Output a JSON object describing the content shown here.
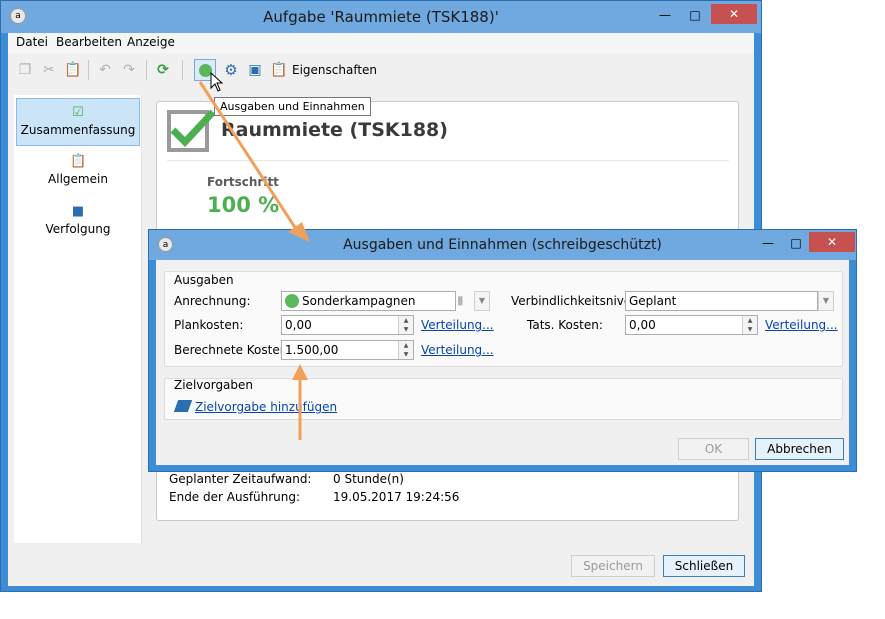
{
  "main_window": {
    "title": "Aufgabe 'Raummiete (TSK188)'",
    "menu": [
      "Datei",
      "Bearbeiten",
      "Anzeige"
    ],
    "toolbar": {
      "properties_label": "Eigenschaften",
      "tooltip": "Ausgaben und Einnahmen"
    },
    "sidebar": [
      {
        "label": "Zusammenfassung",
        "icon": "checklist-icon"
      },
      {
        "label": "Allgemein",
        "icon": "clipboard-icon"
      },
      {
        "label": "Verfolgung",
        "icon": "tracking-icon"
      }
    ],
    "summary": {
      "title": "Raummiete (TSK188)",
      "progress_label": "Fortschritt",
      "progress_value": "100 %",
      "details": [
        {
          "label": "Geplanter Zeitaufwand:",
          "value": "0 Stunde(n)"
        },
        {
          "label": "Ende der Ausführung:",
          "value": "19.05.2017 19:24:56"
        }
      ]
    },
    "buttons": {
      "save": "Speichern",
      "close": "Schließen"
    }
  },
  "dialog": {
    "title": "Ausgaben und Einnahmen (schreibgeschützt)",
    "ausgaben_group": "Ausgaben",
    "anrechnung_label": "Anrechnung:",
    "anrechnung_value": "Sonderkampagnen",
    "verbindlichkeit_label": "Verbindlichkeitsniveau:",
    "verbindlichkeit_value": "Geplant",
    "plankosten_label": "Plankosten:",
    "plankosten_value": "0,00",
    "tats_label": "Tats. Kosten:",
    "tats_value": "0,00",
    "berechnete_label": "Berechnete Kosten:",
    "berechnete_value": "1.500,00",
    "verteilung": "Verteilung...",
    "ziel_group": "Zielvorgaben",
    "ziel_link": "Zielvorgabe hinzufügen",
    "ok": "OK",
    "cancel": "Abbrechen"
  },
  "colors": {
    "accent": "#3c8dd6",
    "success": "#4caf50",
    "link": "#0645ad",
    "annotation": "#f0a05a"
  }
}
